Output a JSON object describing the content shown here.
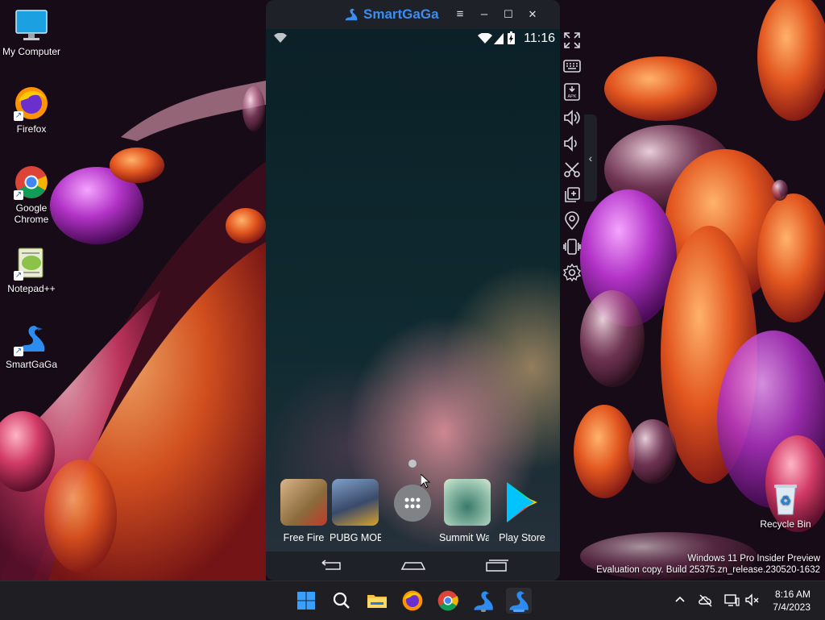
{
  "desktop": {
    "icons": [
      {
        "label": "My Computer"
      },
      {
        "label": "Firefox"
      },
      {
        "label": "Google Chrome"
      },
      {
        "label": "Notepad++"
      },
      {
        "label": "SmartGaGa"
      },
      {
        "label": "Recycle Bin"
      }
    ],
    "watermark": {
      "line1": "Windows 11 Pro Insider Preview",
      "line2": "Evaluation copy. Build 25375.zn_release.230520-1632"
    }
  },
  "emulator": {
    "title": "SmartGaGa",
    "controls": {
      "menu": "≡",
      "minimize": "–",
      "maximize": "☐",
      "close": "✕"
    },
    "status": {
      "time": "11:16"
    },
    "dock": [
      {
        "label": "Free Fire"
      },
      {
        "label": "PUBG MOBILE"
      },
      {
        "label": "Summit Wars"
      },
      {
        "label": "Play Store"
      }
    ],
    "sidebar_icons": [
      "fullscreen-icon",
      "keyboard-icon",
      "apk-install-icon",
      "volume-up-icon",
      "volume-down-icon",
      "screenshot-scissors-icon",
      "multi-instance-icon",
      "location-icon",
      "shake-icon",
      "settings-icon"
    ]
  },
  "taskbar": {
    "apps": [
      "start-icon",
      "search-icon",
      "file-explorer-icon",
      "firefox-icon",
      "chrome-icon",
      "smartgaga-icon",
      "smartgaga-active-icon"
    ],
    "time": "8:16 AM",
    "date": "7/4/2023"
  },
  "colors": {
    "accent": "#3b8ef0",
    "taskbar": "#1f1f23",
    "emulator_frame": "#1e2127"
  }
}
